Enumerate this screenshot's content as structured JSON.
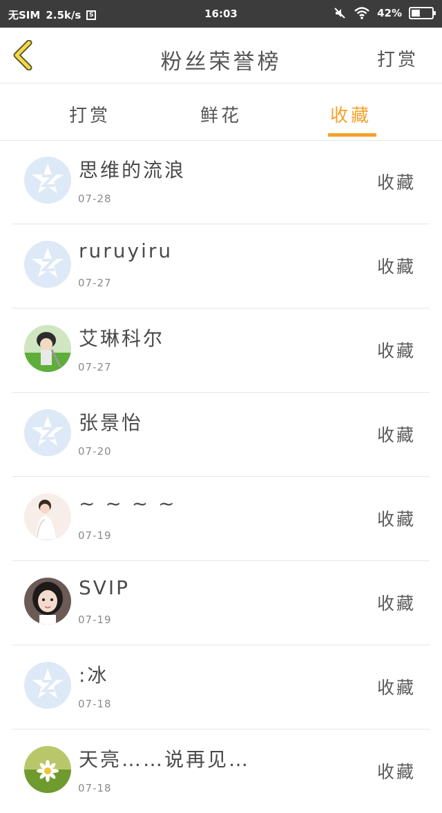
{
  "status_bar": {
    "carrier": "无SIM",
    "speed": "2.5k/s",
    "sim_icon_text": "S",
    "time": "16:03",
    "battery": "42%",
    "battery_level": 0.42
  },
  "header": {
    "title": "粉丝荣誉榜",
    "right_link": "打赏"
  },
  "tabs": [
    {
      "label": "打赏",
      "active": false
    },
    {
      "label": "鲜花",
      "active": false
    },
    {
      "label": "收藏",
      "active": true
    }
  ],
  "colors": {
    "accent": "#f4a22a",
    "status_bar_bg": "#3c3c3c",
    "default_avatar_bg": "#dde9f6"
  },
  "fans": [
    {
      "name": "思维的流浪",
      "date": "07-28",
      "action": "收藏",
      "avatar": "default-avatar-icon"
    },
    {
      "name": "ruruyiru",
      "date": "07-27",
      "action": "收藏",
      "avatar": "default-avatar-icon"
    },
    {
      "name": "艾琳科尔",
      "date": "07-27",
      "action": "收藏",
      "avatar": "anime-character-avatar"
    },
    {
      "name": "张景怡",
      "date": "07-20",
      "action": "收藏",
      "avatar": "default-avatar-icon"
    },
    {
      "name": "~ ~ ~ ~",
      "date": "07-19",
      "action": "收藏",
      "avatar": "girl-photo-avatar"
    },
    {
      "name": "SVIP",
      "date": "07-19",
      "action": "收藏",
      "avatar": "girl-photo-avatar"
    },
    {
      "name": ":冰",
      "date": "07-18",
      "action": "收藏",
      "avatar": "default-avatar-icon"
    },
    {
      "name": "天亮……说再见…",
      "date": "07-18",
      "action": "收藏",
      "avatar": "daisy-photo-avatar"
    }
  ]
}
